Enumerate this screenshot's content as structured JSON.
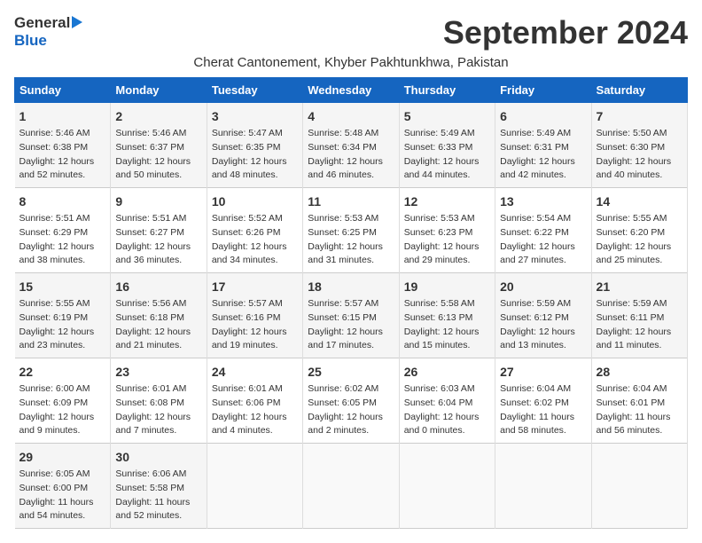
{
  "header": {
    "logo_general": "General",
    "logo_blue": "Blue",
    "month_title": "September 2024",
    "subtitle": "Cherat Cantonement, Khyber Pakhtunkhwa, Pakistan"
  },
  "calendar": {
    "days_of_week": [
      "Sunday",
      "Monday",
      "Tuesday",
      "Wednesday",
      "Thursday",
      "Friday",
      "Saturday"
    ],
    "weeks": [
      [
        {
          "day": "",
          "empty": true
        },
        {
          "day": "",
          "empty": true
        },
        {
          "day": "",
          "empty": true
        },
        {
          "day": "",
          "empty": true
        },
        {
          "day": "",
          "empty": true
        },
        {
          "day": "",
          "empty": true
        },
        {
          "day": "",
          "empty": true
        }
      ]
    ],
    "cells": [
      {
        "num": "",
        "empty": true
      },
      {
        "num": "",
        "empty": true
      },
      {
        "num": "",
        "empty": true
      },
      {
        "num": "",
        "empty": true
      },
      {
        "num": "",
        "empty": true
      },
      {
        "num": "",
        "empty": true
      },
      {
        "num": "",
        "empty": true
      }
    ],
    "rows": [
      [
        {
          "num": "1",
          "empty": false,
          "lines": [
            "Sunrise: 5:46 AM",
            "Sunset: 6:38 PM",
            "Daylight: 12 hours",
            "and 52 minutes."
          ]
        },
        {
          "num": "2",
          "empty": false,
          "lines": [
            "Sunrise: 5:46 AM",
            "Sunset: 6:37 PM",
            "Daylight: 12 hours",
            "and 50 minutes."
          ]
        },
        {
          "num": "3",
          "empty": false,
          "lines": [
            "Sunrise: 5:47 AM",
            "Sunset: 6:35 PM",
            "Daylight: 12 hours",
            "and 48 minutes."
          ]
        },
        {
          "num": "4",
          "empty": false,
          "lines": [
            "Sunrise: 5:48 AM",
            "Sunset: 6:34 PM",
            "Daylight: 12 hours",
            "and 46 minutes."
          ]
        },
        {
          "num": "5",
          "empty": false,
          "lines": [
            "Sunrise: 5:49 AM",
            "Sunset: 6:33 PM",
            "Daylight: 12 hours",
            "and 44 minutes."
          ]
        },
        {
          "num": "6",
          "empty": false,
          "lines": [
            "Sunrise: 5:49 AM",
            "Sunset: 6:31 PM",
            "Daylight: 12 hours",
            "and 42 minutes."
          ]
        },
        {
          "num": "7",
          "empty": false,
          "lines": [
            "Sunrise: 5:50 AM",
            "Sunset: 6:30 PM",
            "Daylight: 12 hours",
            "and 40 minutes."
          ]
        }
      ],
      [
        {
          "num": "8",
          "empty": false,
          "lines": [
            "Sunrise: 5:51 AM",
            "Sunset: 6:29 PM",
            "Daylight: 12 hours",
            "and 38 minutes."
          ]
        },
        {
          "num": "9",
          "empty": false,
          "lines": [
            "Sunrise: 5:51 AM",
            "Sunset: 6:27 PM",
            "Daylight: 12 hours",
            "and 36 minutes."
          ]
        },
        {
          "num": "10",
          "empty": false,
          "lines": [
            "Sunrise: 5:52 AM",
            "Sunset: 6:26 PM",
            "Daylight: 12 hours",
            "and 34 minutes."
          ]
        },
        {
          "num": "11",
          "empty": false,
          "lines": [
            "Sunrise: 5:53 AM",
            "Sunset: 6:25 PM",
            "Daylight: 12 hours",
            "and 31 minutes."
          ]
        },
        {
          "num": "12",
          "empty": false,
          "lines": [
            "Sunrise: 5:53 AM",
            "Sunset: 6:23 PM",
            "Daylight: 12 hours",
            "and 29 minutes."
          ]
        },
        {
          "num": "13",
          "empty": false,
          "lines": [
            "Sunrise: 5:54 AM",
            "Sunset: 6:22 PM",
            "Daylight: 12 hours",
            "and 27 minutes."
          ]
        },
        {
          "num": "14",
          "empty": false,
          "lines": [
            "Sunrise: 5:55 AM",
            "Sunset: 6:20 PM",
            "Daylight: 12 hours",
            "and 25 minutes."
          ]
        }
      ],
      [
        {
          "num": "15",
          "empty": false,
          "lines": [
            "Sunrise: 5:55 AM",
            "Sunset: 6:19 PM",
            "Daylight: 12 hours",
            "and 23 minutes."
          ]
        },
        {
          "num": "16",
          "empty": false,
          "lines": [
            "Sunrise: 5:56 AM",
            "Sunset: 6:18 PM",
            "Daylight: 12 hours",
            "and 21 minutes."
          ]
        },
        {
          "num": "17",
          "empty": false,
          "lines": [
            "Sunrise: 5:57 AM",
            "Sunset: 6:16 PM",
            "Daylight: 12 hours",
            "and 19 minutes."
          ]
        },
        {
          "num": "18",
          "empty": false,
          "lines": [
            "Sunrise: 5:57 AM",
            "Sunset: 6:15 PM",
            "Daylight: 12 hours",
            "and 17 minutes."
          ]
        },
        {
          "num": "19",
          "empty": false,
          "lines": [
            "Sunrise: 5:58 AM",
            "Sunset: 6:13 PM",
            "Daylight: 12 hours",
            "and 15 minutes."
          ]
        },
        {
          "num": "20",
          "empty": false,
          "lines": [
            "Sunrise: 5:59 AM",
            "Sunset: 6:12 PM",
            "Daylight: 12 hours",
            "and 13 minutes."
          ]
        },
        {
          "num": "21",
          "empty": false,
          "lines": [
            "Sunrise: 5:59 AM",
            "Sunset: 6:11 PM",
            "Daylight: 12 hours",
            "and 11 minutes."
          ]
        }
      ],
      [
        {
          "num": "22",
          "empty": false,
          "lines": [
            "Sunrise: 6:00 AM",
            "Sunset: 6:09 PM",
            "Daylight: 12 hours",
            "and 9 minutes."
          ]
        },
        {
          "num": "23",
          "empty": false,
          "lines": [
            "Sunrise: 6:01 AM",
            "Sunset: 6:08 PM",
            "Daylight: 12 hours",
            "and 7 minutes."
          ]
        },
        {
          "num": "24",
          "empty": false,
          "lines": [
            "Sunrise: 6:01 AM",
            "Sunset: 6:06 PM",
            "Daylight: 12 hours",
            "and 4 minutes."
          ]
        },
        {
          "num": "25",
          "empty": false,
          "lines": [
            "Sunrise: 6:02 AM",
            "Sunset: 6:05 PM",
            "Daylight: 12 hours",
            "and 2 minutes."
          ]
        },
        {
          "num": "26",
          "empty": false,
          "lines": [
            "Sunrise: 6:03 AM",
            "Sunset: 6:04 PM",
            "Daylight: 12 hours",
            "and 0 minutes."
          ]
        },
        {
          "num": "27",
          "empty": false,
          "lines": [
            "Sunrise: 6:04 AM",
            "Sunset: 6:02 PM",
            "Daylight: 11 hours",
            "and 58 minutes."
          ]
        },
        {
          "num": "28",
          "empty": false,
          "lines": [
            "Sunrise: 6:04 AM",
            "Sunset: 6:01 PM",
            "Daylight: 11 hours",
            "and 56 minutes."
          ]
        }
      ],
      [
        {
          "num": "29",
          "empty": false,
          "lines": [
            "Sunrise: 6:05 AM",
            "Sunset: 6:00 PM",
            "Daylight: 11 hours",
            "and 54 minutes."
          ]
        },
        {
          "num": "30",
          "empty": false,
          "lines": [
            "Sunrise: 6:06 AM",
            "Sunset: 5:58 PM",
            "Daylight: 11 hours",
            "and 52 minutes."
          ]
        },
        {
          "num": "",
          "empty": true,
          "lines": []
        },
        {
          "num": "",
          "empty": true,
          "lines": []
        },
        {
          "num": "",
          "empty": true,
          "lines": []
        },
        {
          "num": "",
          "empty": true,
          "lines": []
        },
        {
          "num": "",
          "empty": true,
          "lines": []
        }
      ]
    ]
  }
}
